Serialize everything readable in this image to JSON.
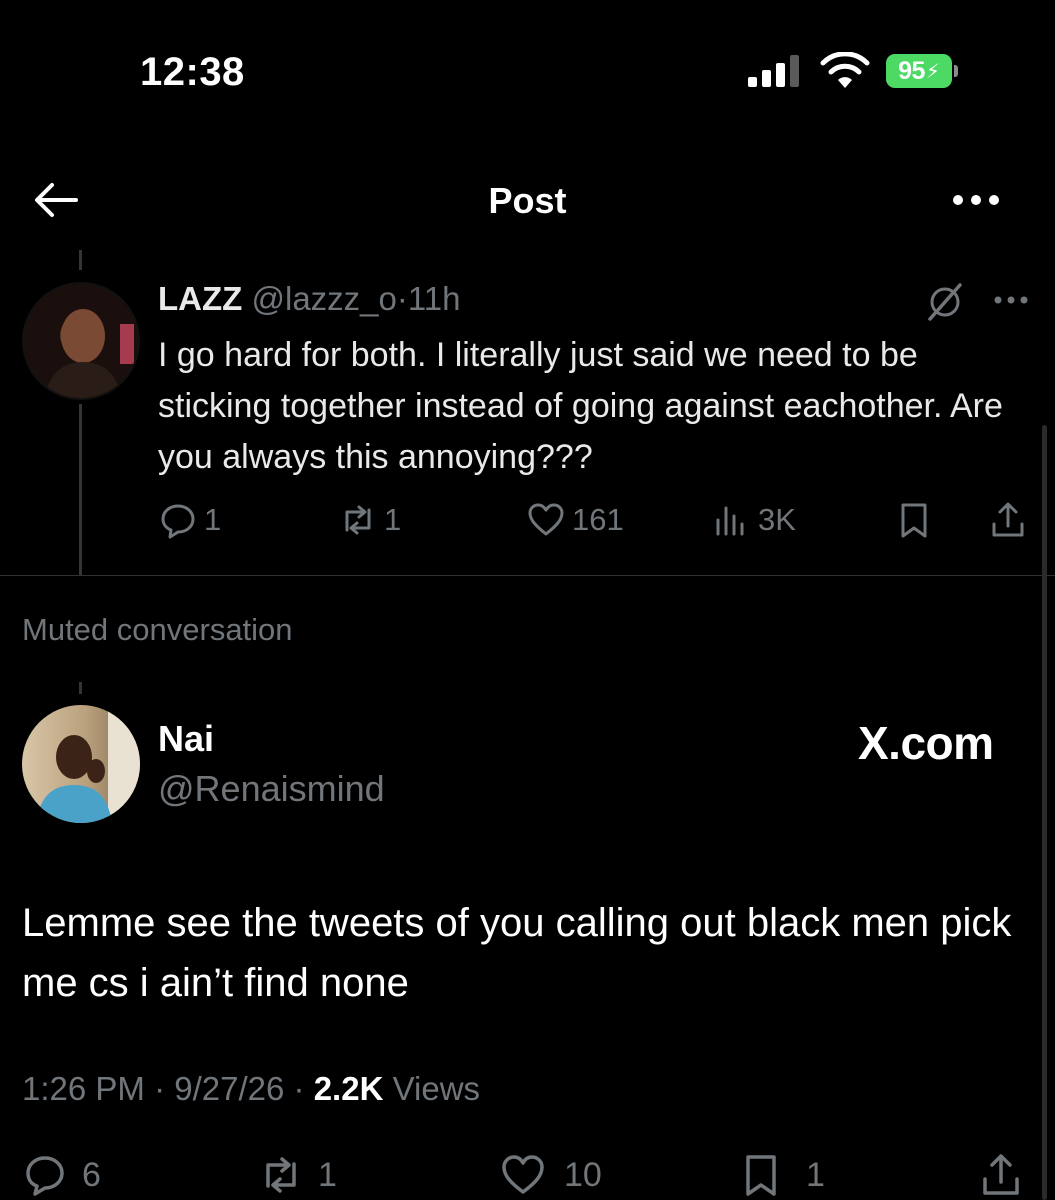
{
  "status_bar": {
    "time": "12:38",
    "battery": "95"
  },
  "header": {
    "title": "Post"
  },
  "reply": {
    "display_name": "LAZZ",
    "handle": "@lazzz_o",
    "separator": "·",
    "age": "11h",
    "text": "I go hard for both. I literally just said we need to be sticking together instead of going against eachother. Are you always this annoying???",
    "stats": {
      "replies": "1",
      "reposts": "1",
      "likes": "161",
      "views": "3K"
    }
  },
  "muted_label": "Muted conversation",
  "post": {
    "display_name": "Nai",
    "handle": "@Renaismind",
    "brand": "X.com",
    "text": "Lemme see the tweets of you calling out black men pick me cs i ain’t find none",
    "time": "1:26 PM",
    "date": "9/27/26",
    "separator": "·",
    "views_count": "2.2K",
    "views_label": "Views",
    "stats": {
      "replies": "6",
      "reposts": "1",
      "likes": "10",
      "bookmarks": "1"
    }
  },
  "colors": {
    "background": "#000000",
    "text": "#e7e9ea",
    "secondary": "#71767b",
    "battery": "#4cd964",
    "divider": "#2f3336"
  },
  "icons": [
    "back-arrow-icon",
    "more-icon",
    "mute-icon",
    "reply-icon",
    "repost-icon",
    "like-icon",
    "views-icon",
    "bookmark-icon",
    "share-icon",
    "signal-icon",
    "wifi-icon",
    "battery-icon"
  ]
}
